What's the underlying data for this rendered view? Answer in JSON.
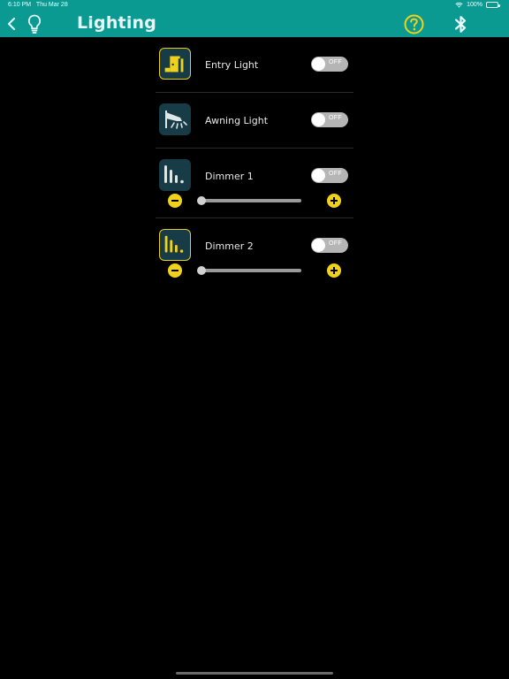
{
  "status_bar": {
    "time": "6:10 PM",
    "date": "Thu Mar 28",
    "battery": "100%"
  },
  "header": {
    "title": "Lighting",
    "back_icon": "chevron-left-icon",
    "app_icon": "lightbulb-icon",
    "help_icon": "question-circle-icon",
    "bluetooth_icon": "bluetooth-icon"
  },
  "lights": [
    {
      "name": "Entry Light",
      "state": "OFF",
      "icon": "door-icon",
      "active_border": true
    },
    {
      "name": "Awning Light",
      "state": "OFF",
      "icon": "awning-light-icon",
      "active_border": false
    },
    {
      "name": "Dimmer 1",
      "state": "OFF",
      "icon": "dimmer-icon",
      "active_border": false,
      "level": 0
    },
    {
      "name": "Dimmer 2",
      "state": "OFF",
      "icon": "dimmer-icon",
      "active_border": true,
      "level": 0
    }
  ],
  "colors": {
    "header_bg": "#0a9a92",
    "accent_yellow": "#f1d21a",
    "icon_bg": "#173c47",
    "background": "#000000"
  }
}
